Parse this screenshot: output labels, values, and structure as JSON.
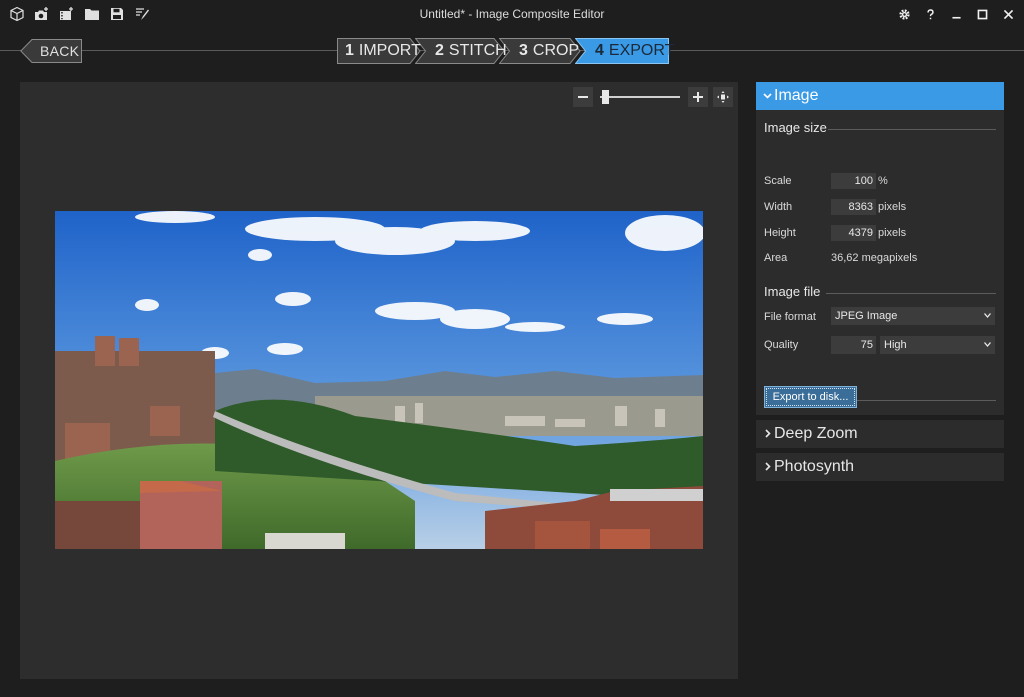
{
  "window": {
    "title": "Untitled* - Image Composite Editor",
    "toolbar_icons": [
      "new-project-icon",
      "new-panorama-from-images-icon",
      "new-panorama-from-video-icon",
      "open-project-icon",
      "save-project-icon",
      "publish-icon"
    ],
    "controls": [
      "settings-icon",
      "help-icon",
      "minimize-icon",
      "maximize-icon",
      "close-icon"
    ]
  },
  "nav": {
    "back_label": "BACK",
    "steps": [
      {
        "num": "1",
        "label": "IMPORT",
        "active": false
      },
      {
        "num": "2",
        "label": "STITCH",
        "active": false
      },
      {
        "num": "3",
        "label": "CROP",
        "active": false
      },
      {
        "num": "4",
        "label": "EXPORT",
        "active": true
      }
    ]
  },
  "zoom": {
    "level": 0.05,
    "icons": [
      "zoom-out-icon",
      "zoom-in-icon",
      "fit-to-window-icon"
    ]
  },
  "panel": {
    "image": {
      "header": "Image",
      "size_title": "Image size",
      "scale_label": "Scale",
      "scale_value": "100",
      "scale_unit": "%",
      "width_label": "Width",
      "width_value": "8363",
      "width_unit": "pixels",
      "height_label": "Height",
      "height_value": "4379",
      "height_unit": "pixels",
      "area_label": "Area",
      "area_value": "36,62 megapixels",
      "file_title": "Image file",
      "format_label": "File format",
      "format_value": "JPEG Image",
      "quality_label": "Quality",
      "quality_value": "75",
      "quality_preset": "High",
      "export_label": "Export to disk..."
    },
    "deep_zoom": {
      "header": "Deep Zoom"
    },
    "photosynth": {
      "header": "Photosynth"
    }
  },
  "colors": {
    "accent": "#3a9ae6",
    "background": "#1e1e1e",
    "panel": "#2c2c2c",
    "canvas": "#2d2d2d"
  }
}
